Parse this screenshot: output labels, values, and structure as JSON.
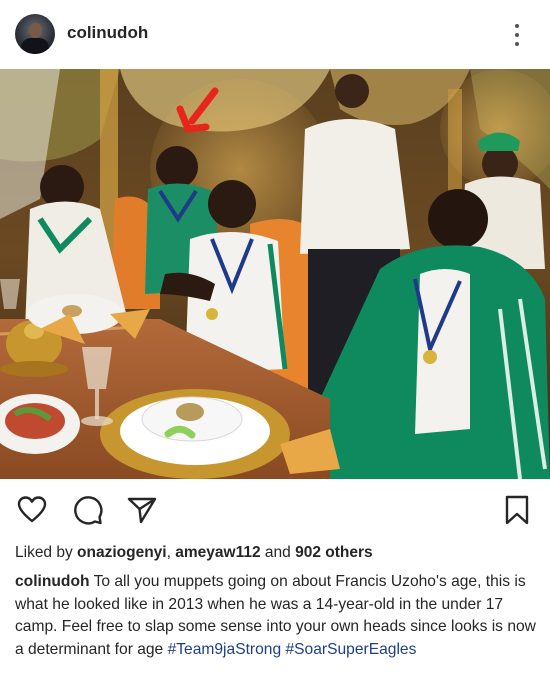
{
  "post": {
    "username": "colinudoh",
    "likes": {
      "prefix": "Liked by",
      "user1": "onaziogenyi",
      "sep": ",",
      "user2": "ameyaw112",
      "and_text": "and",
      "others": "902 others"
    },
    "caption": {
      "username": "colinudoh",
      "text": "To all you muppets going on about Francis Uzoho's age, this is what he looked like in 2013 when he was a 14-year-old in the under 17 camp. Feel free to slap some sense into your own heads since looks is now a determinant for age",
      "hashtag1": "#Team9jaStrong",
      "hashtag2": "#SoarSuperEagles"
    }
  },
  "icons": {
    "more": "more-vertical-icon",
    "like": "heart-icon",
    "comment": "comment-icon",
    "share": "send-icon",
    "save": "bookmark-icon"
  },
  "colors": {
    "text": "#262626",
    "hashtag": "#1d3f8a",
    "arrow": "#e8251d",
    "tracksuit": "#0f8a5f"
  }
}
